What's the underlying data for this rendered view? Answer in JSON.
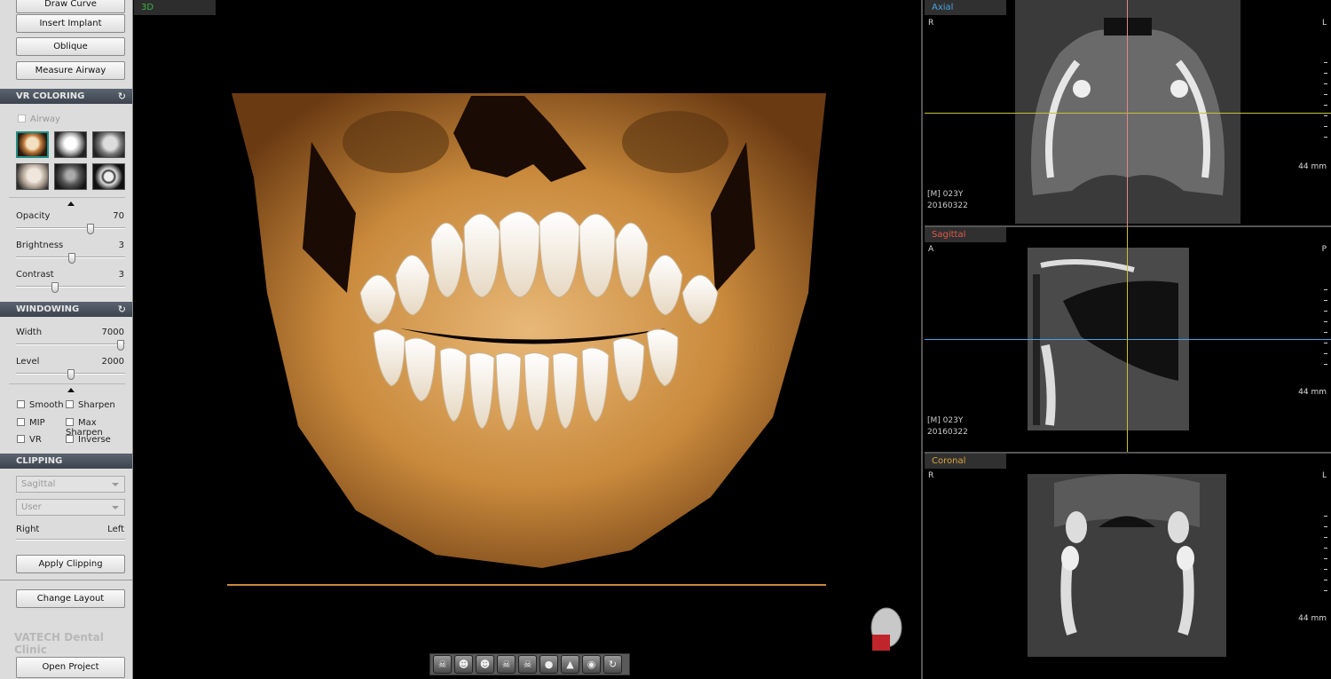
{
  "left_panel": {
    "tools": {
      "draw_curve": "Draw Curve",
      "insert_implant": "Insert Implant",
      "oblique": "Oblique",
      "measure_airway": "Measure Airway"
    },
    "vr_coloring": {
      "title": "VR COLORING",
      "airway_label": "Airway",
      "presets": [
        "bone-orange",
        "bone-white",
        "skin-gray",
        "skin-light",
        "bone-dark",
        "skull-gear"
      ],
      "opacity_label": "Opacity",
      "opacity_value": "70",
      "brightness_label": "Brightness",
      "brightness_value": "3",
      "contrast_label": "Contrast",
      "contrast_value": "3"
    },
    "windowing": {
      "title": "WINDOWING",
      "width_label": "Width",
      "width_value": "7000",
      "level_label": "Level",
      "level_value": "2000",
      "smooth": "Smooth",
      "sharpen": "Sharpen",
      "mip": "MIP",
      "max_sharpen": "Max Sharpen",
      "vr": "VR",
      "inverse": "Inverse"
    },
    "clipping": {
      "title": "CLIPPING",
      "plane_select": "Sagittal",
      "mode_select": "User",
      "right_label": "Right",
      "left_label": "Left",
      "apply_label": "Apply Clipping"
    },
    "change_layout": "Change Layout",
    "brand": "VATECH Dental Clinic",
    "open_project": "Open Project"
  },
  "view3d": {
    "title": "3D",
    "title_color": "#3fb34a",
    "toolbar_icons": [
      "skull-front-icon",
      "skull-left-icon",
      "skull-right-icon",
      "skull-top-icon",
      "skull-bottom-icon",
      "head-back-icon",
      "head-up-icon",
      "sphere-icon",
      "rotate-icon"
    ]
  },
  "slices": {
    "axial": {
      "title": "Axial",
      "title_color": "#4aa3e0",
      "left": "R",
      "right": "L",
      "patient": "[M] 023Y",
      "date": "20160322",
      "scale": "44 mm"
    },
    "sagittal": {
      "title": "Sagittal",
      "title_color": "#e05a4a",
      "left": "A",
      "right": "P",
      "patient": "[M] 023Y",
      "date": "20160322",
      "scale": "44 mm"
    },
    "coronal": {
      "title": "Coronal",
      "title_color": "#d9a53a",
      "left": "R",
      "right": "L",
      "scale": "44 mm"
    }
  },
  "colors": {
    "axial_line": "#c9c23a",
    "sagittal_line": "#4aa3e0",
    "vertical_line": "#e08a8a",
    "accent": "#1f8f86"
  }
}
